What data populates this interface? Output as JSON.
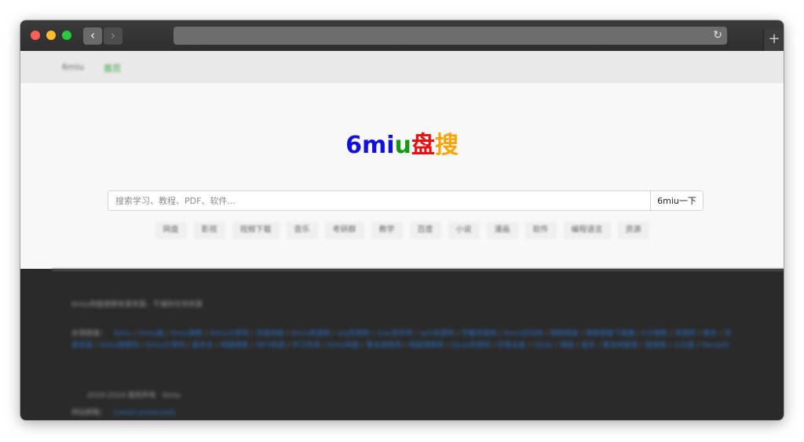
{
  "browser": {
    "nav_back_icon": "‹",
    "nav_forward_icon": "›",
    "reload_icon": "↻",
    "new_tab_icon": "+",
    "address": ""
  },
  "site_nav": {
    "home": "6miu",
    "active": "首页"
  },
  "logo": {
    "part1": "6mi",
    "part2": "u",
    "part3": "盘",
    "part4": "搜",
    "colors": [
      "#1010e0",
      "#159a15",
      "#e81010",
      "#f7a408"
    ]
  },
  "search": {
    "placeholder": "搜索学习、教程、PDF、软件...",
    "value": "",
    "button_label": "6miu一下"
  },
  "tags": [
    "网盘",
    "影视",
    "视频下载",
    "音乐",
    "考研群",
    "教学",
    "百度",
    "小说",
    "漫画",
    "软件",
    "编程语言",
    "资源"
  ],
  "footer": {
    "description": "6miu网盘搜索收录资源，不储存任何资源",
    "friend_links_label": "友情链接：",
    "friend_links": [
      "6miu",
      "6miu盘",
      "6miu搜索",
      "6miu分享网",
      "百度网盘",
      "6miu资源网",
      "aiq资源网",
      "mac软件网",
      "aim资源网",
      "学霸资源网",
      "6miu论坛网",
      "搜索链接",
      "搜索链接下载器",
      "ICE搜索",
      "资源网",
      "聚合",
      "百度资源",
      "6miu搜索网",
      "6miu分享网",
      "盘多多",
      "网盘搜索",
      "MP3资源",
      "学习资源",
      "6miu网盘",
      "聚合搜索网",
      "网盘搜索网",
      "Epub资源网",
      "阿里云盘",
      "CDisk",
      "搜盘",
      "盘多",
      "聚合网盘搜",
      "盘搜搜",
      "小白盘",
      "Pansplit"
    ],
    "copyright": "2019-2024 版权所有 · 6miu",
    "contact_label": "网站邮箱：",
    "contact_value": "[email protected]"
  }
}
